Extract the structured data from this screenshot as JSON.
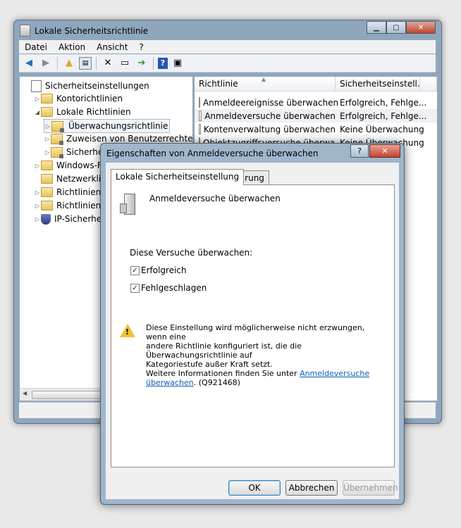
{
  "main_window": {
    "title": "Lokale Sicherheitsrichtlinie",
    "menu": [
      "Datei",
      "Aktion",
      "Ansicht",
      "?"
    ],
    "tree": [
      {
        "label": "Sicherheitseinstellungen",
        "level": 0,
        "expander": "",
        "icon": "shield-doc-icon"
      },
      {
        "label": "Kontorichtlinien",
        "level": 1,
        "expander": "▷",
        "icon": "folder-icon"
      },
      {
        "label": "Lokale Richtlinien",
        "level": 1,
        "expander": "◢",
        "icon": "folder-icon"
      },
      {
        "label": "Überwachungsrichtlinie",
        "level": 2,
        "expander": "▷",
        "icon": "folder-lock-icon",
        "selected": true
      },
      {
        "label": "Zuweisen von Benutzerrechten",
        "level": 2,
        "expander": "▷",
        "icon": "folder-lock-icon"
      },
      {
        "label": "Sicherheit",
        "level": 2,
        "expander": "▷",
        "icon": "folder-lock-icon"
      },
      {
        "label": "Windows-Fire",
        "level": 1,
        "expander": "▷",
        "icon": "folder-icon"
      },
      {
        "label": "Netzwerkliste",
        "level": 1,
        "expander": "",
        "icon": "folder-icon"
      },
      {
        "label": "Richtlinien fü",
        "level": 1,
        "expander": "▷",
        "icon": "folder-icon"
      },
      {
        "label": "Richtlinien fü",
        "level": 1,
        "expander": "▷",
        "icon": "folder-icon"
      },
      {
        "label": "IP-Sicherheits",
        "level": 1,
        "expander": "▷",
        "icon": "shield-icon"
      }
    ],
    "list_columns": [
      "Richtlinie",
      "Sicherheitseinstell..."
    ],
    "list_rows": [
      {
        "policy": "Anmeldeereignisse überwachen",
        "setting": "Erfolgreich, Fehlge..."
      },
      {
        "policy": "Anmeldeversuche überwachen",
        "setting": "Erfolgreich, Fehlge...",
        "selected": true
      },
      {
        "policy": "Kontenverwaltung überwachen",
        "setting": "Keine Überwachung"
      },
      {
        "policy": "Objektzugriffsversuche überwa...",
        "setting": "Keine Überwachung"
      }
    ]
  },
  "dialog": {
    "title": "Eigenschaften von Anmeldeversuche überwachen",
    "help_label": "?",
    "close_label": "✕",
    "tabs": [
      "Lokale Sicherheitseinstellung",
      "Erklärung"
    ],
    "policy_name": "Anmeldeversuche überwachen",
    "group_label": "Diese Versuche überwachen:",
    "checkboxes": [
      {
        "label": "Erfolgreich",
        "checked": true
      },
      {
        "label": "Fehlgeschlagen",
        "checked": true
      }
    ],
    "warning_lines": [
      "Diese Einstellung wird möglicherweise nicht erzwungen, wenn eine",
      "andere Richtlinie konfiguriert ist, die die Überwachungsrichtlinie auf",
      "Kategoriestufe außer Kraft setzt."
    ],
    "more_info_prefix": "Weitere Informationen finden Sie unter ",
    "more_info_link_1": "Anmeldeversuche",
    "more_info_link_2": "überwachen",
    "more_info_suffix": ". (Q921468)",
    "buttons": {
      "ok": "OK",
      "cancel": "Abbrechen",
      "apply": "Übernehmen"
    }
  },
  "colors": {
    "link": "#0a5fb4",
    "frame": "#9fb6cb"
  }
}
